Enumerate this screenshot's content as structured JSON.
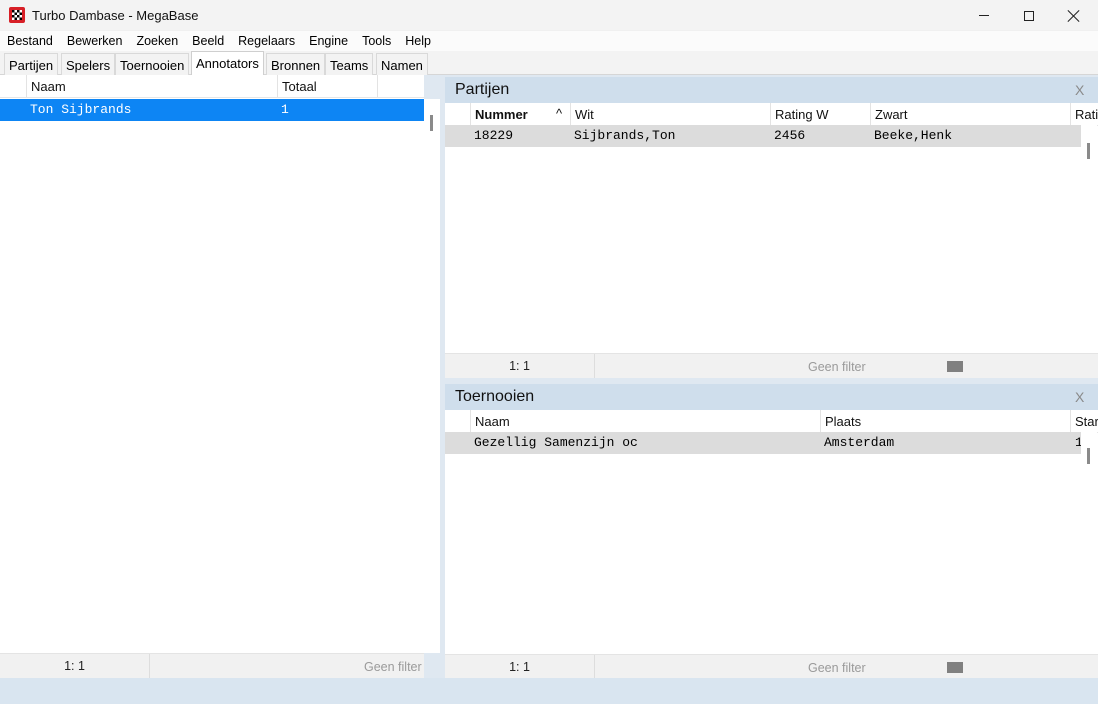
{
  "window": {
    "title": "Turbo Dambase - MegaBase"
  },
  "menu": [
    "Bestand",
    "Bewerken",
    "Zoeken",
    "Beeld",
    "Regelaars",
    "Engine",
    "Tools",
    "Help"
  ],
  "tabs": [
    {
      "label": "Partijen",
      "active": false
    },
    {
      "label": "Spelers",
      "active": false
    },
    {
      "label": "Toernooien",
      "active": false
    },
    {
      "label": "Annotators",
      "active": true
    },
    {
      "label": "Bronnen",
      "active": false
    },
    {
      "label": "Teams",
      "active": false
    },
    {
      "label": "Namen",
      "active": false
    }
  ],
  "annotators": {
    "columns": [
      "Naam",
      "Totaal"
    ],
    "rows": [
      {
        "naam": "Ton Sijbrands",
        "totaal": "1",
        "selected": true
      }
    ],
    "status": {
      "count": "1: 1",
      "filter": "Geen filter"
    }
  },
  "partijen_panel": {
    "title": "Partijen",
    "close": "X",
    "columns": [
      "Nummer",
      "Wit",
      "Rating W",
      "Zwart",
      "Rati"
    ],
    "sort_indicator": "^",
    "rows": [
      {
        "nummer": "18229",
        "wit": "Sijbrands,Ton",
        "rating_w": "2456",
        "zwart": "Beeke,Henk"
      }
    ],
    "status": {
      "count": "1: 1",
      "filter": "Geen filter"
    }
  },
  "toernooien_panel": {
    "title": "Toernooien",
    "close": "X",
    "columns": [
      "Naam",
      "Plaats",
      "Star"
    ],
    "rows": [
      {
        "naam": "Gezellig Samenzijn oc",
        "plaats": "Amsterdam",
        "start": "1"
      }
    ],
    "status": {
      "count": "1: 1",
      "filter": "Geen filter"
    }
  },
  "colors": {
    "selection": "#0d85f4",
    "panel_header": "#cfdeec",
    "background": "#dfe8f1"
  }
}
